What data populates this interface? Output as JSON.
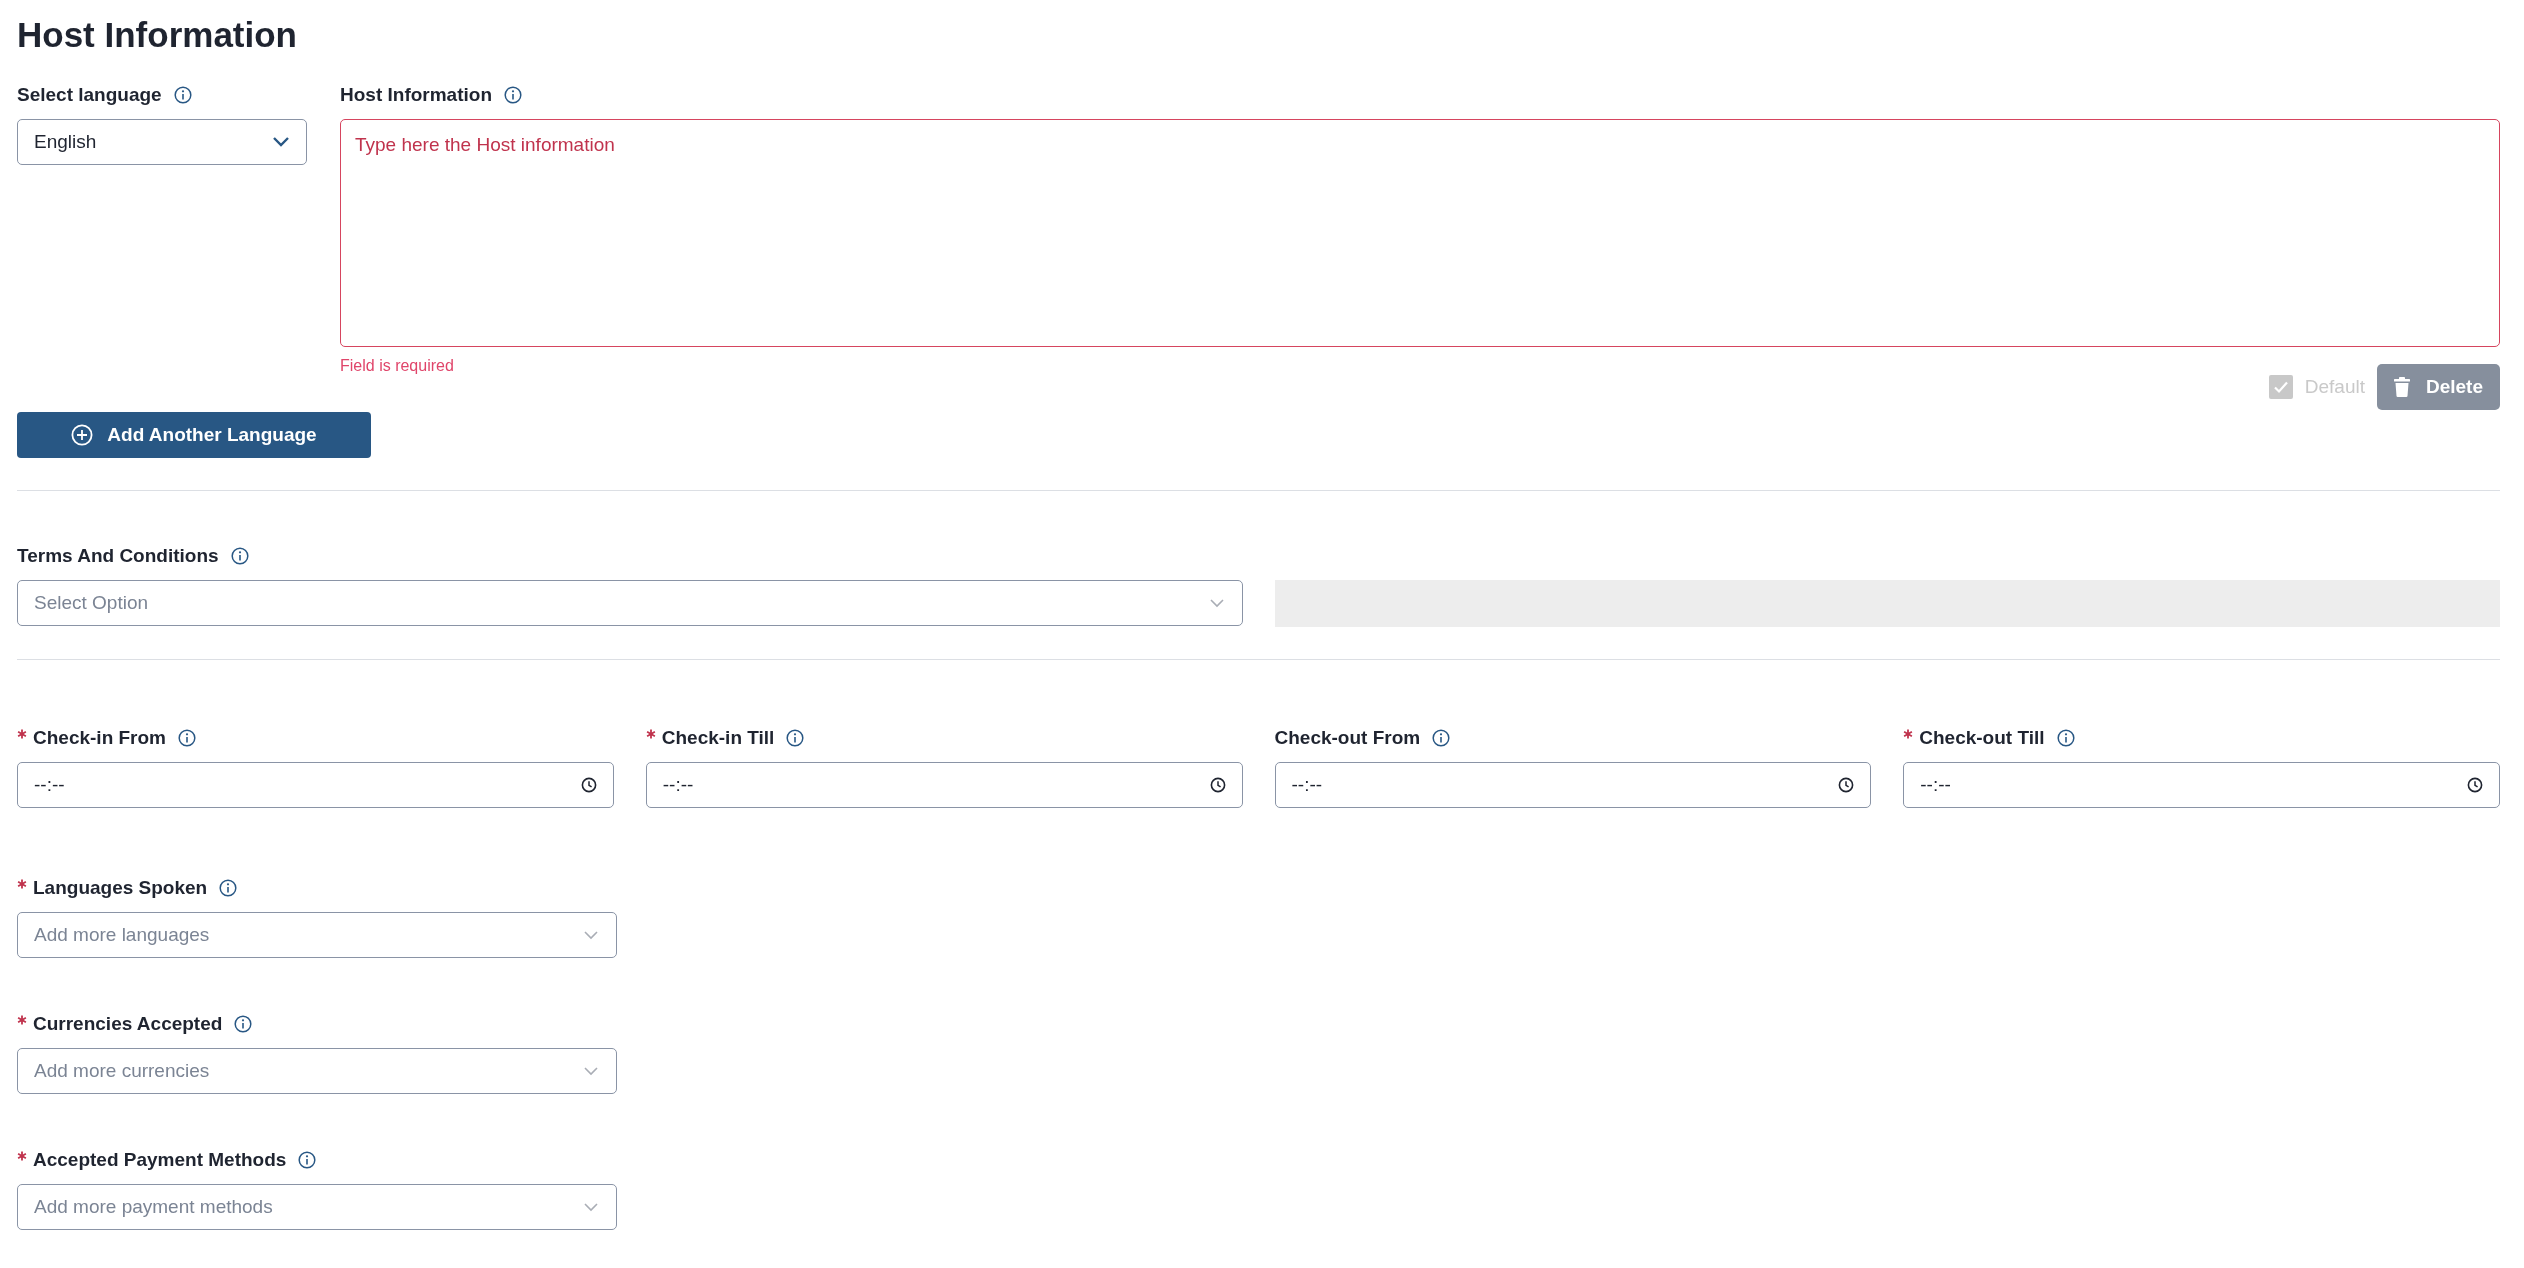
{
  "page": {
    "title": "Host Information"
  },
  "host_info": {
    "language": {
      "label": "Select language",
      "value": "English"
    },
    "description": {
      "label": "Host Information",
      "placeholder": "Type here the Host information",
      "error": "Field is required",
      "invalid": true
    },
    "default": {
      "label": "Default",
      "checked": true,
      "disabled": true
    },
    "delete_button": {
      "label": "Delete",
      "disabled": true
    },
    "add_button": {
      "label": "Add Another Language"
    }
  },
  "terms": {
    "label": "Terms And Conditions",
    "placeholder": "Select Option"
  },
  "times": [
    {
      "label": "Check-in From",
      "required": true,
      "value": "--:--"
    },
    {
      "label": "Check-in Till",
      "required": true,
      "value": "--:--"
    },
    {
      "label": "Check-out From",
      "required": false,
      "value": "--:--"
    },
    {
      "label": "Check-out Till",
      "required": true,
      "value": "--:--"
    }
  ],
  "selects": [
    {
      "label": "Languages Spoken",
      "required": true,
      "placeholder": "Add more languages"
    },
    {
      "label": "Currencies Accepted",
      "required": true,
      "placeholder": "Add more currencies"
    },
    {
      "label": "Accepted Payment Methods",
      "required": true,
      "placeholder": "Add more payment methods"
    }
  ]
}
